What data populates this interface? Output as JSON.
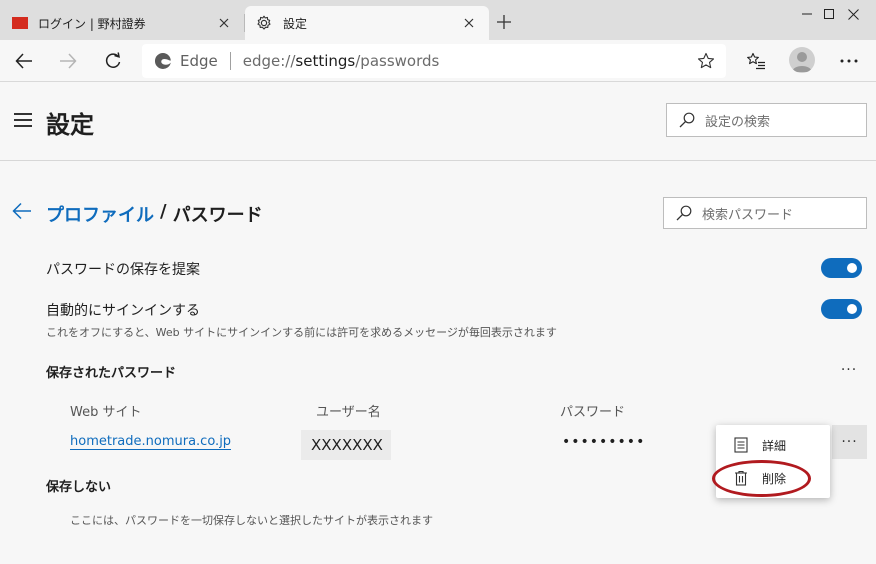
{
  "tabs": [
    {
      "title": "ログイン | 野村證券",
      "favicon": "nomura-red-logo",
      "active": false
    },
    {
      "title": "設定",
      "favicon": "gear-icon",
      "active": true
    }
  ],
  "window_controls": {
    "minimize": "minimize-icon",
    "maximize": "maximize-icon",
    "close": "close-icon"
  },
  "address_bar": {
    "site_label": "Edge",
    "url_scheme": "edge://",
    "url_host": "settings",
    "url_path": "/passwords"
  },
  "header": {
    "title": "設定",
    "search_placeholder": "設定の検索"
  },
  "breadcrumb": {
    "parent": "プロファイル",
    "separator": "/",
    "current": "パスワード"
  },
  "password_search_placeholder": "検索パスワード",
  "settings": {
    "offer_save": {
      "label": "パスワードの保存を提案",
      "enabled": true
    },
    "auto_signin": {
      "label": "自動的にサインインする",
      "description": "これをオフにすると、Web サイトにサインインする前には許可を求めるメッセージが毎回表示されます",
      "enabled": true
    }
  },
  "saved_passwords": {
    "title": "保存されたパスワード",
    "more": "···",
    "columns": [
      "Web サイト",
      "ユーザー名",
      "パスワード"
    ],
    "rows": [
      {
        "site": "hometrade.nomura.co.jp",
        "username": "XXXXXXX",
        "password": "•••••••••",
        "more": "···"
      }
    ]
  },
  "context_menu": {
    "items": [
      {
        "label": "詳細",
        "icon": "details-icon"
      },
      {
        "label": "削除",
        "icon": "trash-icon"
      }
    ]
  },
  "never_saved": {
    "title": "保存しない",
    "hint": "ここには、パスワードを一切保存しないと選択したサイトが表示されます"
  },
  "colors": {
    "accent": "#0f6cbd",
    "highlight_ring": "#b11a1f",
    "nomura_red": "#d42b1e"
  }
}
